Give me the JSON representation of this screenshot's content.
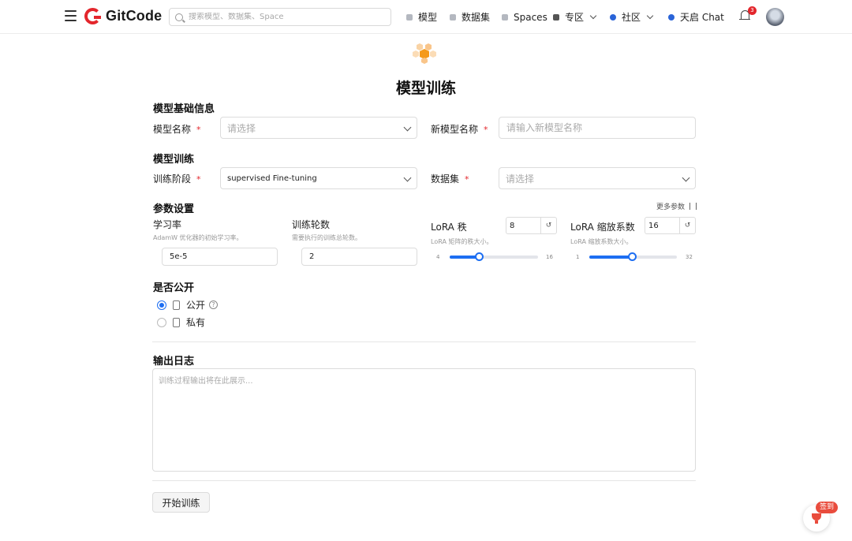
{
  "header": {
    "brand": "GitCode",
    "search_placeholder": "搜索模型、数据集、Space",
    "nav": [
      "模型",
      "数据集",
      "Spaces",
      "专区",
      "社区",
      "天启 Chat"
    ],
    "notification_count": "3"
  },
  "page": {
    "title": "模型训练"
  },
  "basic_info": {
    "section_title": "模型基础信息",
    "model_name_label": "模型名称",
    "model_name_placeholder": "请选择",
    "new_model_name_label": "新模型名称",
    "new_model_name_placeholder": "请输入新模型名称",
    "required_mark": "*"
  },
  "training": {
    "section_title": "模型训练",
    "stage_label": "训练阶段",
    "stage_value": "supervised Fine-tuning",
    "dataset_label": "数据集",
    "dataset_placeholder": "请选择"
  },
  "params": {
    "section_title": "参数设置",
    "more_params": "更多参数",
    "learning_rate": {
      "label": "学习率",
      "hint": "AdamW 优化器的初始学习率。",
      "value": "5e-5"
    },
    "epochs": {
      "label": "训练轮数",
      "hint": "需要执行的训练总轮数。",
      "value": "2"
    },
    "lora_rank": {
      "label": "LoRA 秩",
      "hint": "LoRA 矩阵的秩大小。",
      "value": "8",
      "min": "4",
      "max": "16",
      "fraction": 0.3333
    },
    "lora_alpha": {
      "label": "LoRA 缩放系数",
      "hint": "LoRA 缩放系数大小。",
      "value": "16",
      "min": "1",
      "max": "32",
      "fraction": 0.4839
    },
    "reset_glyph": "↺"
  },
  "visibility": {
    "section_title": "是否公开",
    "options": [
      {
        "label": "公开",
        "selected": true
      },
      {
        "label": "私有",
        "selected": false
      }
    ],
    "help_glyph": "?"
  },
  "output": {
    "section_title": "输出日志",
    "placeholder": "训练过程输出将在此展示..."
  },
  "actions": {
    "start_label": "开始训练",
    "checkin_label": "签到"
  },
  "colors": {
    "brand_red": "#e3262c",
    "accent_blue": "#1d6ef2"
  }
}
